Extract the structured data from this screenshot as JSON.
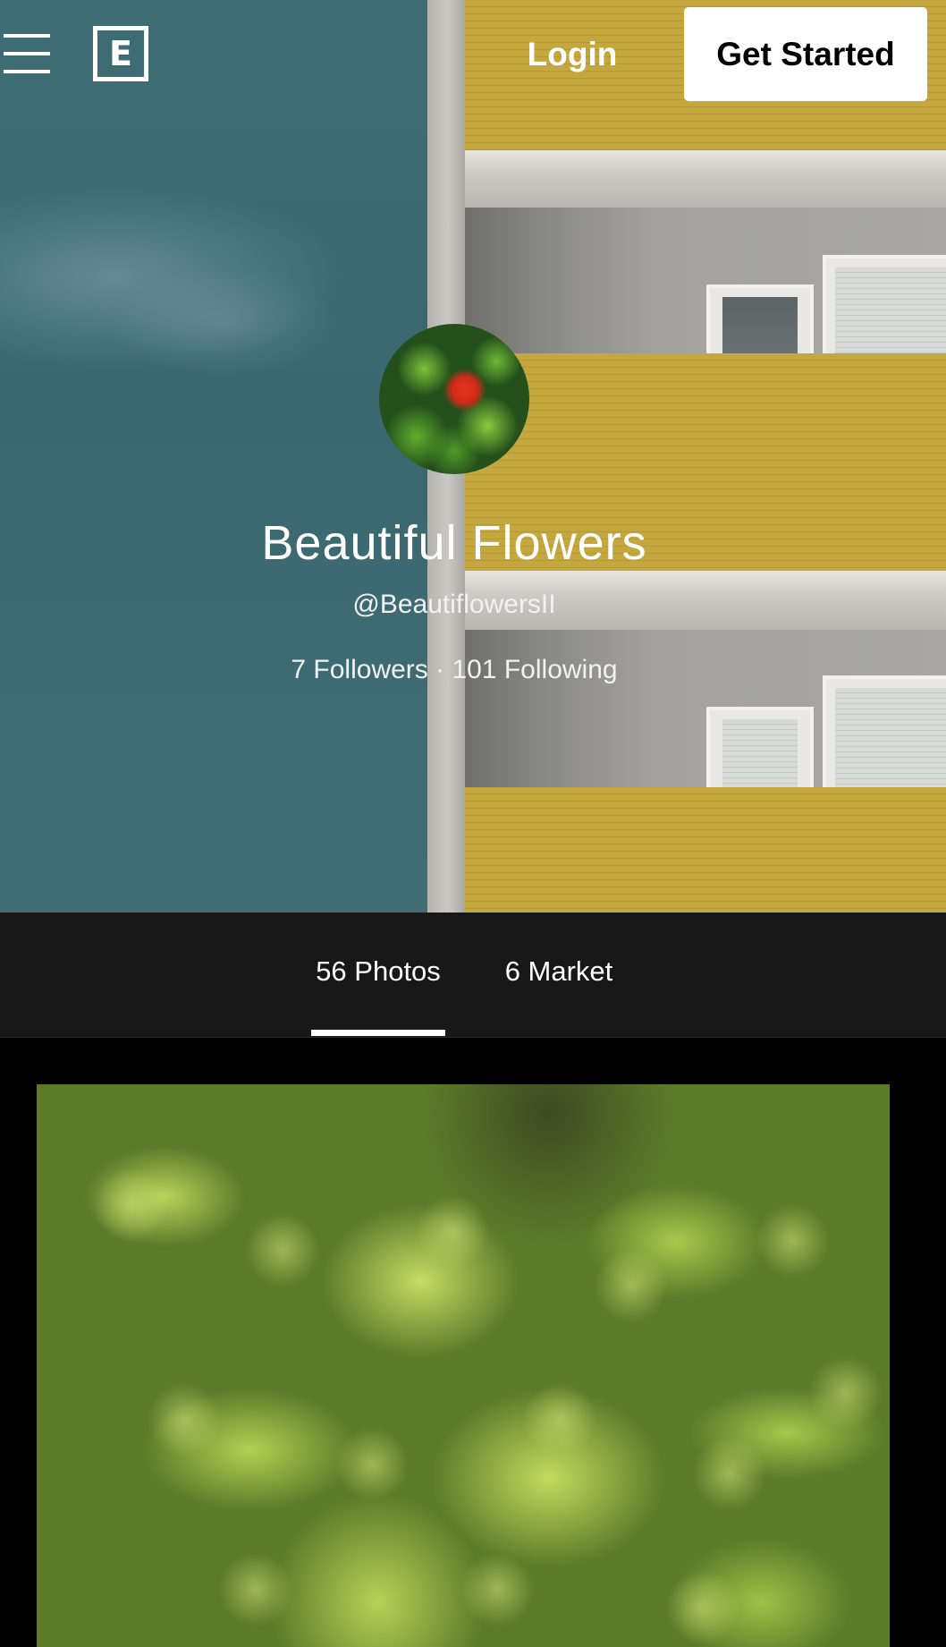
{
  "topbar": {
    "menu_icon": "hamburger-menu-icon",
    "logo_letter": "E",
    "login_label": "Login",
    "cta_label": "Get Started"
  },
  "profile": {
    "name": "Beautiful Flowers",
    "handle": "@BeautiflowersII",
    "followers": "7 Followers",
    "separator": " · ",
    "following": "101 Following"
  },
  "tabs": [
    {
      "label": "56 Photos",
      "active": true
    },
    {
      "label": "6 Market",
      "active": false
    }
  ],
  "colors": {
    "tabbar_bg": "#181818",
    "cta_bg": "#ffffff",
    "page_bg": "#000000"
  }
}
